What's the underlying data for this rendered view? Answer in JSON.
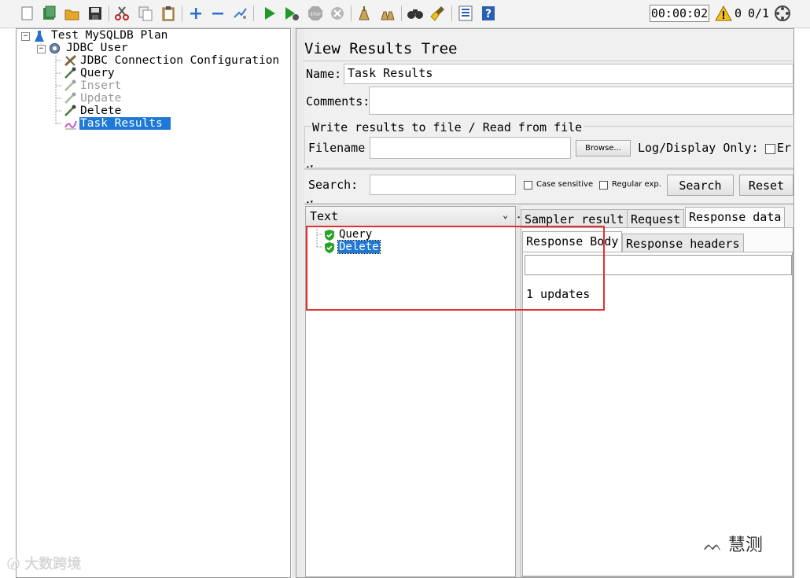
{
  "toolbar": {
    "icons": [
      "new-icon",
      "templates-icon",
      "open-icon",
      "save-icon",
      "cut-icon",
      "copy-icon",
      "paste-icon",
      "expand-icon",
      "collapse-icon",
      "toggle-icon",
      "start-icon",
      "start-no-pause-icon",
      "stop-icon",
      "shutdown-icon",
      "clear-icon",
      "clear-all-icon",
      "search-icon",
      "reset-search-icon",
      "function-helper-icon",
      "help-icon",
      "remote-icon"
    ],
    "timer": "00:00:02",
    "warning_count": "0",
    "thread_count": "0/1"
  },
  "tree": {
    "plan": "Test MySQLDB Plan",
    "thread_group": "JDBC User",
    "children": [
      {
        "label": "JDBC Connection Configuration",
        "state": "enabled"
      },
      {
        "label": "Query",
        "state": "enabled"
      },
      {
        "label": "Insert",
        "state": "disabled"
      },
      {
        "label": "Update",
        "state": "disabled"
      },
      {
        "label": "Delete",
        "state": "enabled"
      },
      {
        "label": "Task Results",
        "state": "selected"
      }
    ]
  },
  "panel": {
    "title": "View Results Tree",
    "name_label": "Name:",
    "name_value": "Task Results",
    "comments_label": "Comments:",
    "comments_value": "",
    "file_section": {
      "legend": "Write results to file / Read from file",
      "filename_label": "Filename",
      "filename_value": "",
      "browse_label": "Browse...",
      "log_display_label": "Log/Display Only:",
      "errors_label": "Er"
    },
    "search": {
      "label": "Search:",
      "value": "",
      "case_sensitive_label": "Case sensitive",
      "regex_label": "Regular exp.",
      "search_button": "Search",
      "reset_button": "Reset"
    },
    "renderer": "Text",
    "results": [
      {
        "label": "Query",
        "status": "success"
      },
      {
        "label": "Delete",
        "status": "success"
      }
    ],
    "tabs": [
      "Sampler result",
      "Request",
      "Response data"
    ],
    "subtabs": [
      "Response Body",
      "Response headers"
    ],
    "response_search": "",
    "response_text": "1 updates"
  },
  "watermarks": {
    "left": "大数跨境",
    "right": "慧测"
  },
  "colors": {
    "selection": "#1e78d7",
    "highlight_box": "#e03030",
    "success": "#2aa22a"
  }
}
